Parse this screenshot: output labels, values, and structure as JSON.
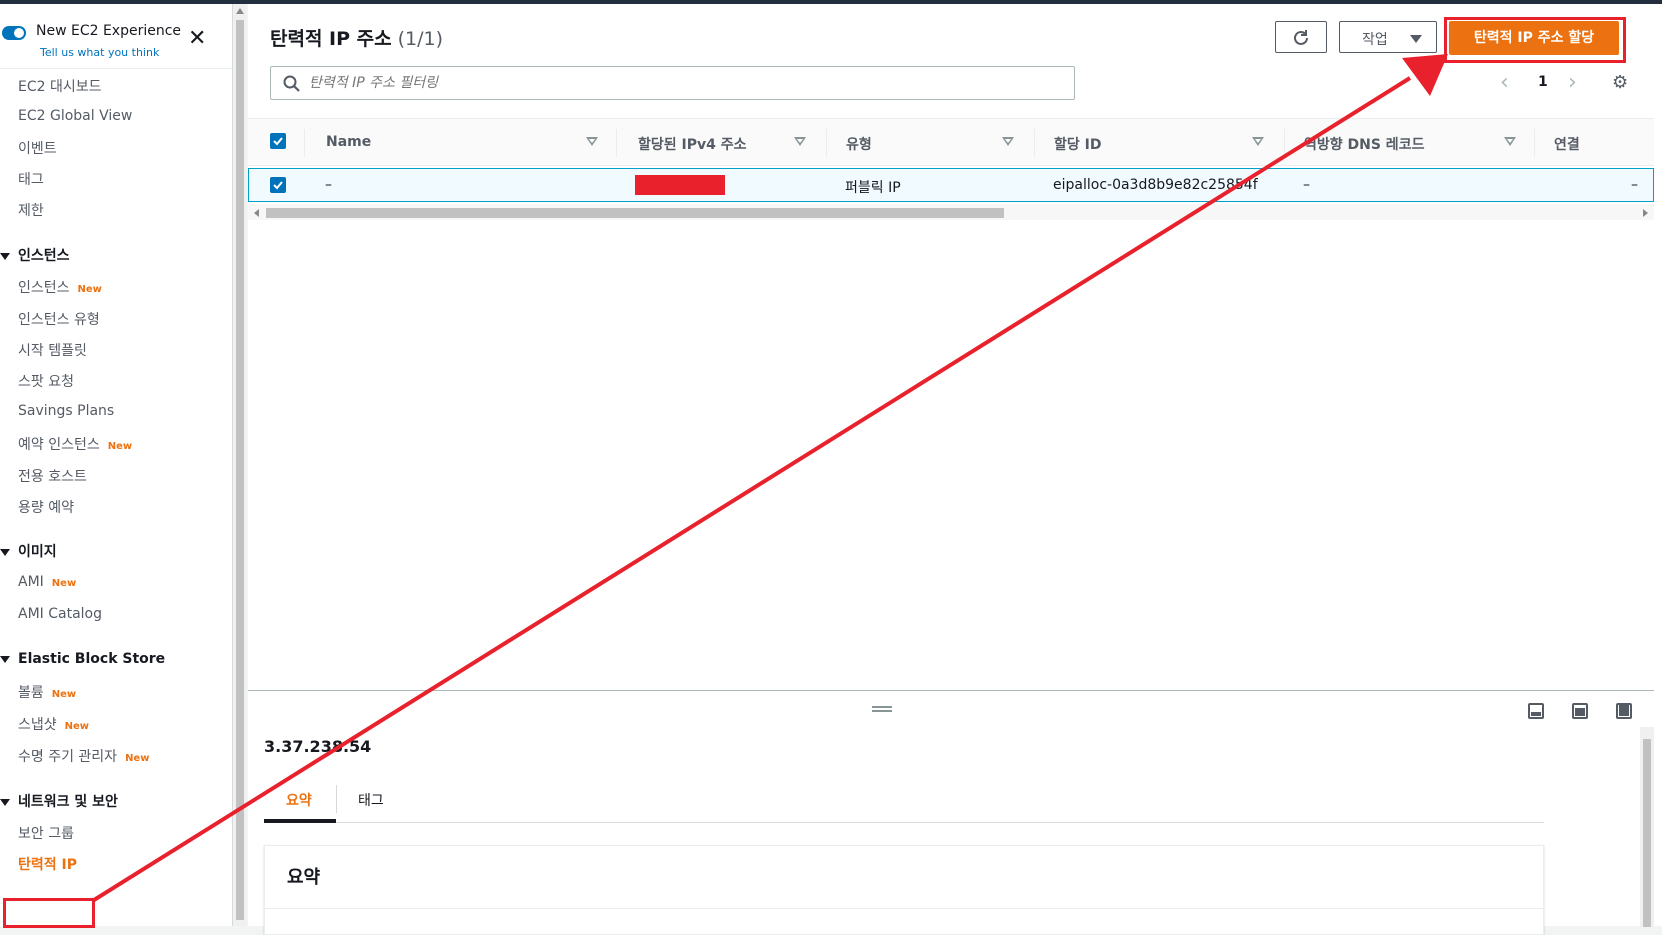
{
  "experience": {
    "title": "New EC2 Experience",
    "link": "Tell us what you think"
  },
  "nav": {
    "top": [
      "EC2 대시보드",
      "EC2 Global View",
      "이벤트",
      "태그",
      "제한"
    ],
    "sections": [
      {
        "title": "인스턴스",
        "items": [
          {
            "label": "인스턴스",
            "badge": "New"
          },
          {
            "label": "인스턴스 유형",
            "badge": ""
          },
          {
            "label": "시작 템플릿",
            "badge": ""
          },
          {
            "label": "스팟 요청",
            "badge": ""
          },
          {
            "label": "Savings Plans",
            "badge": ""
          },
          {
            "label": "예약 인스턴스",
            "badge": "New"
          },
          {
            "label": "전용 호스트",
            "badge": ""
          },
          {
            "label": "용량 예약",
            "badge": ""
          }
        ]
      },
      {
        "title": "이미지",
        "items": [
          {
            "label": "AMI",
            "badge": "New"
          },
          {
            "label": "AMI Catalog",
            "badge": ""
          }
        ]
      },
      {
        "title": "Elastic Block Store",
        "items": [
          {
            "label": "볼륨",
            "badge": "New"
          },
          {
            "label": "스냅샷",
            "badge": "New"
          },
          {
            "label": "수명 주기 관리자",
            "badge": "New"
          }
        ]
      },
      {
        "title": "네트워크 및 보안",
        "items": [
          {
            "label": "보안 그룹",
            "badge": ""
          },
          {
            "label": "탄력적 IP",
            "badge": ""
          }
        ]
      }
    ]
  },
  "header": {
    "title": "탄력적 IP 주소",
    "count": "(1/1)",
    "actions_label": "작업",
    "allocate_label": "탄력적 IP 주소 할당"
  },
  "search": {
    "placeholder": "탄력적 IP 주소 필터링"
  },
  "pagination": {
    "page": "1",
    "prev": "‹",
    "next": "›"
  },
  "table": {
    "columns": [
      "Name",
      "할당된 IPv4 주소",
      "유형",
      "할당 ID",
      "역방향 DNS 레코드",
      "연결"
    ],
    "rows": [
      {
        "name": "–",
        "ipv4": "",
        "type": "퍼블릭 IP",
        "allocation_id": "eipalloc-0a3d8b9e82c25854f",
        "reverse_dns": "–",
        "association": "–"
      }
    ]
  },
  "detail": {
    "title": "3.37.238.54",
    "tabs": [
      "요약",
      "태그"
    ],
    "summary_title": "요약"
  },
  "colors": {
    "accent": "#ec7211",
    "link": "#0073bb",
    "highlight": "#e8212d"
  }
}
